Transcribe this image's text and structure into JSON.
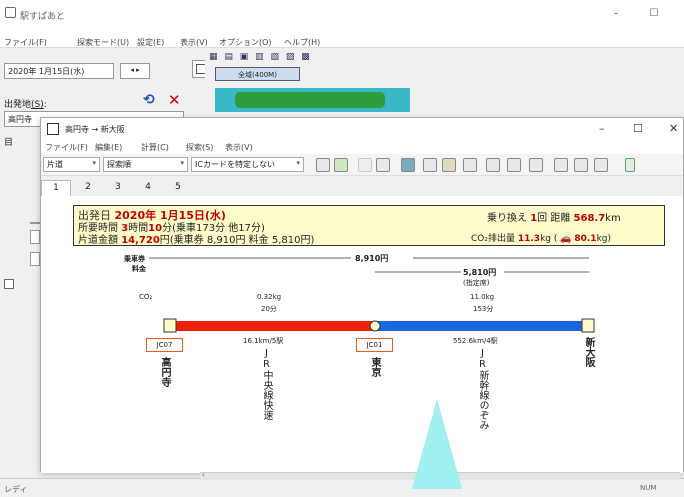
{
  "main_window": {
    "title": "駅すぱあと",
    "menu": [
      "ファイル(F)",
      "探索モード(U)",
      "設定(E)",
      "表示(V)",
      "オプション(O)",
      "ヘルプ(H)"
    ],
    "date": "2020年 1月15日(水)",
    "departure_label": "出発地",
    "departure_hotkey": "(S)",
    "departure_value": "高円寺",
    "dest_prefix": "目",
    "map_button": "全域(400M)",
    "status_left": "レディ",
    "status_right": "NUM"
  },
  "route_window": {
    "title": "高円寺 → 新大阪",
    "menu": [
      "ファイル(F)",
      "編集(E)",
      "計算(C)",
      "探索(S)",
      "表示(V)"
    ],
    "selects": {
      "trip": "片道",
      "sort": "探索順",
      "ic": "ICカードを特定しない"
    },
    "tabs": [
      "1",
      "2",
      "3",
      "4",
      "5"
    ],
    "summary": {
      "dep_label": "出発日",
      "dep_value": "2020年 1月15日(水)",
      "time_label": "所要時間",
      "time_h": "3",
      "time_h_unit": "時間",
      "time_m": "10",
      "time_rest": "分(乗車173分 他17分)",
      "fare_label": "片道金額",
      "fare_value": "14,720",
      "fare_rest": "円(乗車券 8,910円 料金 5,810円)",
      "transfer_label": "乗り換え",
      "transfer_value": "1",
      "transfer_unit": "回",
      "dist_label": "距離",
      "dist_value": "568.7",
      "dist_unit": "km",
      "co2_label": "CO₂排出量",
      "co2_value": "11.3",
      "co2_unit": "kg",
      "car_value": "80.1",
      "car_unit": "kg"
    },
    "route": {
      "ticket_label": "乗車券",
      "fee_label": "料金",
      "ticket_fare": "8,910円",
      "fee_value": "5,810円",
      "fee_note": "(指定席)",
      "co2_label": "CO₂",
      "seg1": {
        "co2": "0.32kg",
        "time": "20分",
        "dist": "16.1km/5駅",
        "line": "JR中央線快速",
        "color": "#ee2200"
      },
      "seg2": {
        "co2": "11.0kg",
        "time": "153分",
        "dist": "552.6km/4駅",
        "line": "JR新幹線のぞみ",
        "color": "#1a66dd"
      },
      "stations": [
        {
          "code": "JC07",
          "name": "高円寺"
        },
        {
          "code": "JC01",
          "name": "東京"
        },
        {
          "code": "",
          "name": "新大阪"
        }
      ]
    }
  }
}
